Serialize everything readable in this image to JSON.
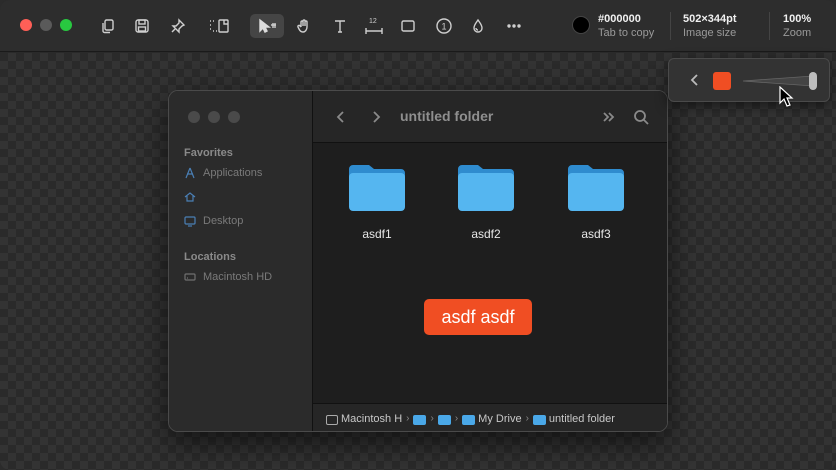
{
  "toolbar": {
    "icons": [
      "copy-icon",
      "save-icon",
      "pin-icon",
      "crop-icon",
      "select-pointer-icon",
      "hand-icon",
      "text-icon",
      "measure-icon",
      "rectangle-icon",
      "counter-icon",
      "blur-icon",
      "more-icon"
    ],
    "measure_label": "12",
    "counter_label": "1",
    "color": {
      "value": "#000000",
      "label": "Tab to copy"
    },
    "size": {
      "value": "502×344pt",
      "label": "Image size"
    },
    "zoom": {
      "value": "100%",
      "label": "Zoom"
    }
  },
  "finder": {
    "title": "untitled folder",
    "sidebar": {
      "favorites_title": "Favorites",
      "favorites": [
        {
          "label": "Applications",
          "icon": "applications-icon"
        },
        {
          "label": "",
          "icon": "home-icon"
        },
        {
          "label": "Desktop",
          "icon": "desktop-icon"
        }
      ],
      "locations_title": "Locations",
      "locations": [
        {
          "label": "Macintosh HD",
          "icon": "disk-icon"
        }
      ]
    },
    "folders": [
      {
        "name": "asdf1"
      },
      {
        "name": "asdf2"
      },
      {
        "name": "asdf3"
      }
    ],
    "tag_text": "asdf asdf",
    "pathbar": {
      "items": [
        "Macintosh HD",
        "",
        "",
        "My Drive",
        "untitled folder"
      ],
      "first_truncated": "Macintosh H"
    }
  },
  "popover": {
    "swatch_color": "#f04e23",
    "slider_level": 1.0
  },
  "colors": {
    "accent": "#f04e23",
    "folder_blue": "#4aa8e8"
  }
}
